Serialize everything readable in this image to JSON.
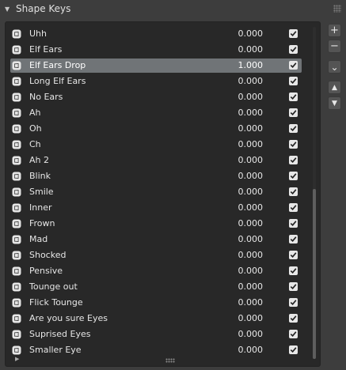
{
  "panel": {
    "title": "Shape Keys"
  },
  "side_buttons": {
    "add": "+",
    "remove": "−",
    "specials": "⌄",
    "move_up": "▲",
    "move_down": "▼"
  },
  "shape_keys": [
    {
      "name": "Uhh",
      "value": "0.000",
      "enabled": true
    },
    {
      "name": "Elf Ears",
      "value": "0.000",
      "enabled": true
    },
    {
      "name": "Elf Ears Drop",
      "value": "1.000",
      "enabled": true,
      "selected": true
    },
    {
      "name": "Long Elf Ears",
      "value": "0.000",
      "enabled": true
    },
    {
      "name": "No Ears",
      "value": "0.000",
      "enabled": true
    },
    {
      "name": "Ah",
      "value": "0.000",
      "enabled": true
    },
    {
      "name": "Oh",
      "value": "0.000",
      "enabled": true
    },
    {
      "name": "Ch",
      "value": "0.000",
      "enabled": true
    },
    {
      "name": "Ah 2",
      "value": "0.000",
      "enabled": true
    },
    {
      "name": "Blink",
      "value": "0.000",
      "enabled": true
    },
    {
      "name": "Smile",
      "value": "0.000",
      "enabled": true
    },
    {
      "name": "Inner",
      "value": "0.000",
      "enabled": true
    },
    {
      "name": "Frown",
      "value": "0.000",
      "enabled": true
    },
    {
      "name": "Mad",
      "value": "0.000",
      "enabled": true
    },
    {
      "name": "Shocked",
      "value": "0.000",
      "enabled": true
    },
    {
      "name": "Pensive",
      "value": "0.000",
      "enabled": true
    },
    {
      "name": "Tounge out",
      "value": "0.000",
      "enabled": true
    },
    {
      "name": "Flick Tounge",
      "value": "0.000",
      "enabled": true
    },
    {
      "name": "Are you sure Eyes",
      "value": "0.000",
      "enabled": true
    },
    {
      "name": "Suprised Eyes",
      "value": "0.000",
      "enabled": true
    },
    {
      "name": "Smaller Eye",
      "value": "0.000",
      "enabled": true
    }
  ],
  "icons": {
    "row": "shape-key-icon",
    "check": "checkmark-icon"
  }
}
